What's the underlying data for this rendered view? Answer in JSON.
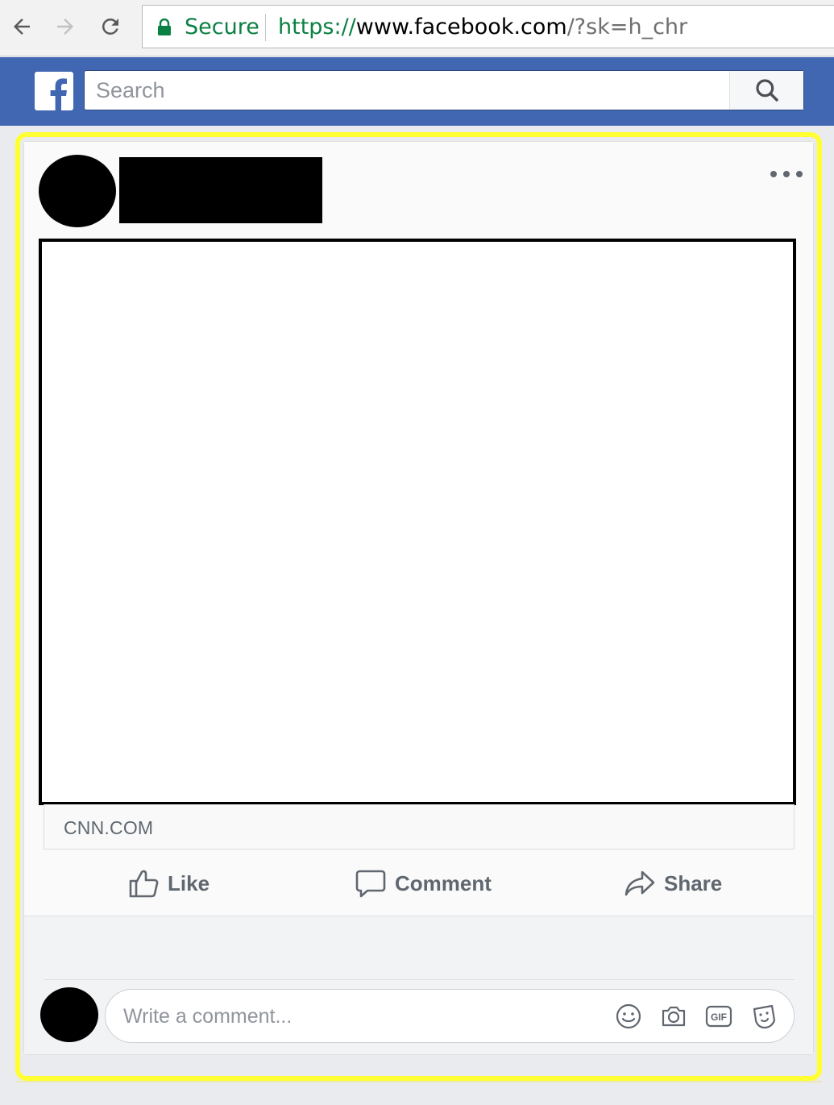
{
  "browser": {
    "secure_label": "Secure",
    "url_scheme": "https://",
    "url_host": "www.facebook.com",
    "url_rest": "/?sk=h_chr"
  },
  "fb_header": {
    "search_placeholder": "Search"
  },
  "post": {
    "link_domain": "CNN.COM",
    "actions": {
      "like_label": "Like",
      "comment_label": "Comment",
      "share_label": "Share"
    },
    "comment_placeholder": "Write a comment...",
    "comment_gif_label": "GIF"
  },
  "colors": {
    "fb_blue": "#4267b2",
    "highlight": "#ffff33",
    "secure_green": "#0b8043",
    "action_gray": "#606770"
  },
  "icons": [
    "back-icon",
    "forward-icon",
    "reload-icon",
    "lock-icon",
    "facebook-logo",
    "search-icon",
    "more-options-icon",
    "like-icon",
    "comment-icon",
    "share-icon",
    "emoji-icon",
    "camera-icon",
    "gif-icon",
    "sticker-icon"
  ]
}
